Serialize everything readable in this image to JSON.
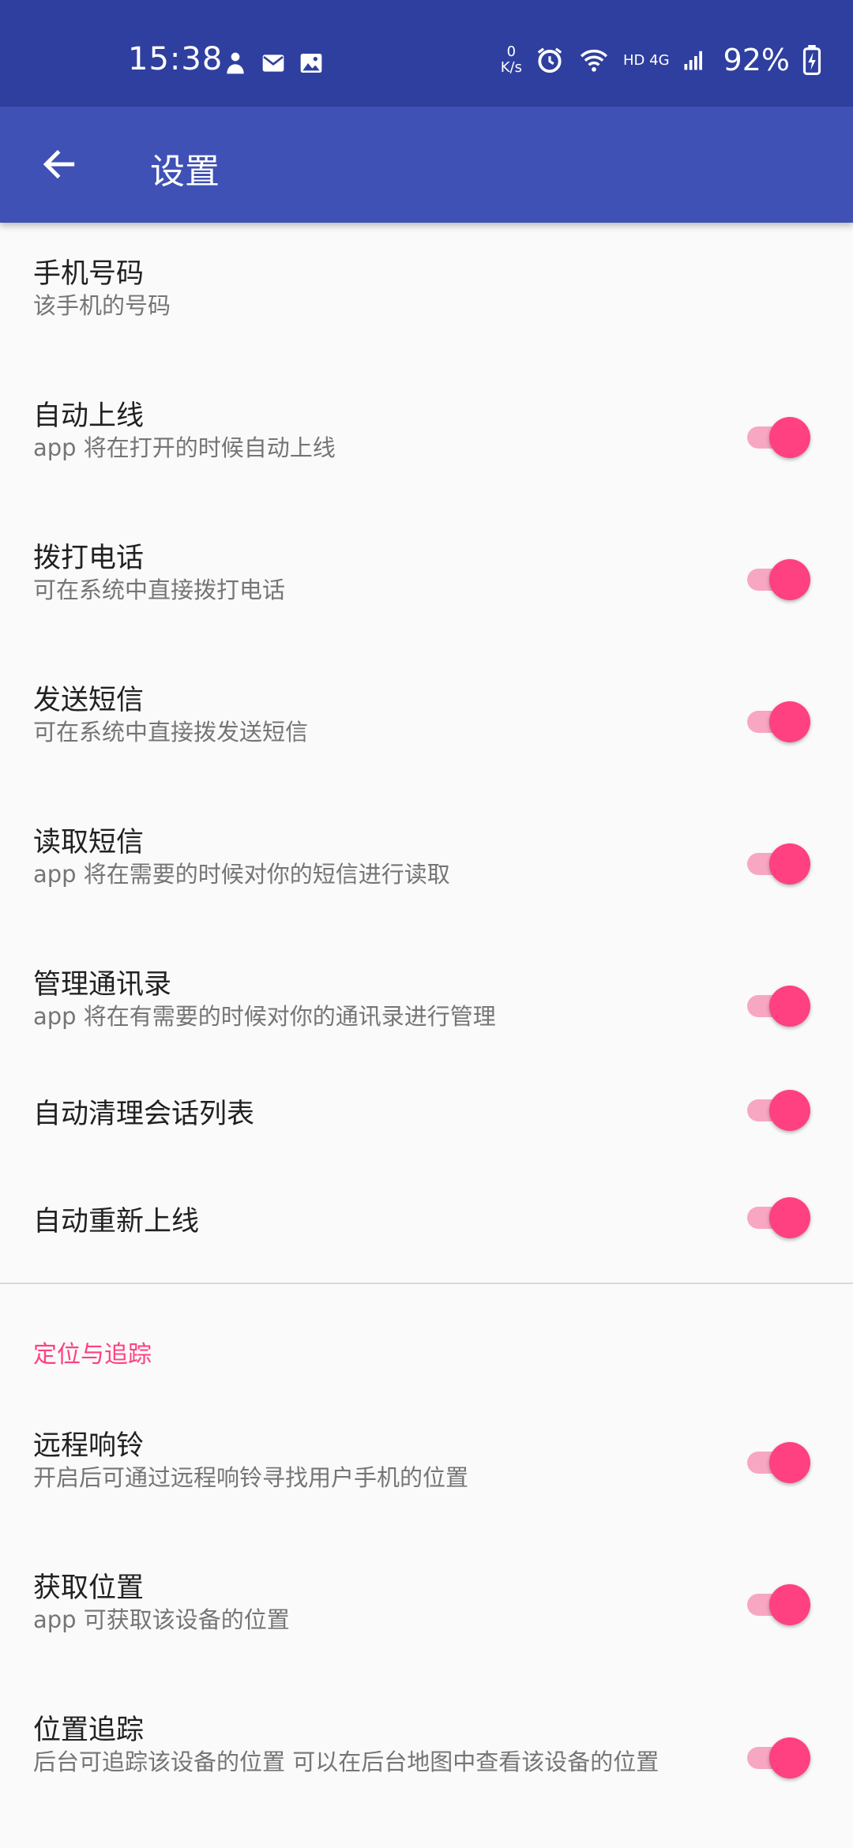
{
  "status_bar": {
    "time": "15:38",
    "net_speed_value": "0",
    "net_speed_unit": "K/s",
    "network_type": "HD 4G",
    "battery": "92%",
    "icons": [
      "person-icon",
      "mail-icon",
      "image-icon",
      "alarm-icon",
      "wifi-icon",
      "signal-icon",
      "battery-charging-icon"
    ]
  },
  "app_bar": {
    "title": "设置",
    "back_icon": "arrow-left-icon"
  },
  "settings": [
    {
      "title": "手机号码",
      "summary": "该手机的号码",
      "has_switch": false
    },
    {
      "title": "自动上线",
      "summary": "app 将在打开的时候自动上线",
      "has_switch": true,
      "on": true
    },
    {
      "title": "拨打电话",
      "summary": "可在系统中直接拨打电话",
      "has_switch": true,
      "on": true
    },
    {
      "title": "发送短信",
      "summary": "可在系统中直接拨发送短信",
      "has_switch": true,
      "on": true
    },
    {
      "title": "读取短信",
      "summary": "app 将在需要的时候对你的短信进行读取",
      "has_switch": true,
      "on": true
    },
    {
      "title": "管理通讯录",
      "summary": "app 将在有需要的时候对你的通讯录进行管理",
      "has_switch": true,
      "on": true
    },
    {
      "title": "自动清理会话列表",
      "has_switch": true,
      "on": true
    },
    {
      "title": "自动重新上线",
      "has_switch": true,
      "on": true
    }
  ],
  "section_location": {
    "header": "定位与追踪",
    "items": [
      {
        "title": "远程响铃",
        "summary": "开启后可通过远程响铃寻找用户手机的位置",
        "has_switch": true,
        "on": true
      },
      {
        "title": "获取位置",
        "summary": " app 可获取该设备的位置",
        "has_switch": true,
        "on": true
      },
      {
        "title": "位置追踪",
        "summary": "后台可追踪该设备的位置 可以在后台地图中查看该设备的位置",
        "has_switch": true,
        "on": true
      }
    ]
  },
  "colors": {
    "status_bar": "#2f3f9f",
    "app_bar": "#3f51b5",
    "accent": "#ff4081",
    "switch_track": "#f8a7c2"
  }
}
